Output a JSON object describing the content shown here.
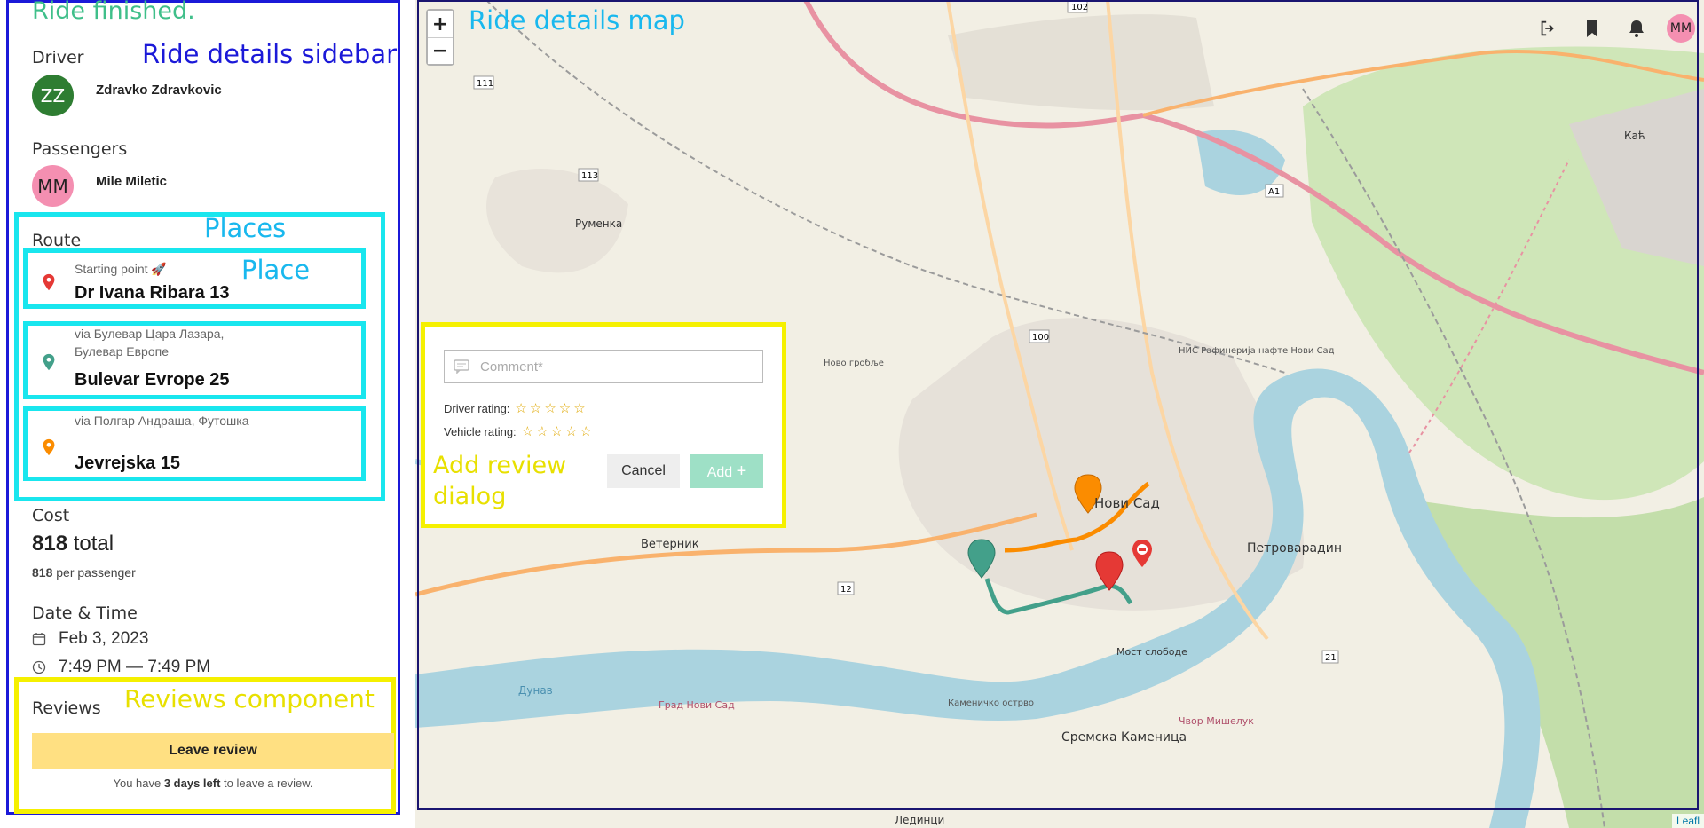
{
  "sidebar": {
    "overlay_label": "Ride details sidebar",
    "status": "Ride finished.",
    "driver": {
      "title": "Driver",
      "initials": "ZZ",
      "name": "Zdravko Zdravkovic"
    },
    "passengers": {
      "title": "Passengers",
      "items": [
        {
          "initials": "MM",
          "name": "Mile Miletic"
        }
      ]
    },
    "route": {
      "title": "Route",
      "places_label": "Places",
      "place_label": "Place",
      "places": [
        {
          "sub": "Starting point 🚀",
          "main": "Dr Ivana Ribara 13",
          "color": "#e53935"
        },
        {
          "sub": "via Булевар Цара Лазара, Булевар Европе",
          "main": "Bulevar Evrope 25",
          "color": "#43a08a"
        },
        {
          "sub": "via Полгар Андраша, Футошка",
          "main": "Jevrejska 15",
          "color": "#fb8c00"
        }
      ]
    },
    "cost": {
      "title": "Cost",
      "total_value": "818",
      "total_suffix": "total",
      "per_value": "818",
      "per_suffix": "per passenger"
    },
    "datetime": {
      "title": "Date & Time",
      "date": "Feb 3, 2023",
      "time": "7:49 PM — 7:49 PM"
    },
    "reviews": {
      "title": "Reviews",
      "overlay_label": "Reviews component",
      "button": "Leave review",
      "note_prefix": "You have ",
      "note_bold": "3 days left",
      "note_suffix": " to leave a review."
    }
  },
  "map": {
    "overlay_label": "Ride details map",
    "zoom_in": "+",
    "zoom_out": "−",
    "avatar_initials": "MM",
    "attribution": "Leafl",
    "labels": {
      "novi_sad": "Нови Сад",
      "petrovaradin": "Петроварадин",
      "sremska": "Сремска Каменица",
      "veternik": "Ветерник",
      "rumenka": "Руменка",
      "dunav": "Дунав",
      "most": "Мост слободе",
      "grad": "Град Нови Сад",
      "ledinci": "Лединци",
      "kac": "Каћ",
      "nis": "НИС Рафинерија нафте Нови Сад",
      "novo_groblje": "Ново гробље",
      "cvor": "Чвор Мишелук",
      "kamenicko": "Каменичко острво"
    },
    "road_numbers": [
      "102",
      "111",
      "113",
      "100",
      "12",
      "21",
      "A1"
    ]
  },
  "dialog": {
    "overlay_label": "Add review dialog",
    "comment_placeholder": "Comment*",
    "driver_rating_label": "Driver rating:",
    "vehicle_rating_label": "Vehicle rating:",
    "stars": "☆☆☆☆☆",
    "cancel": "Cancel",
    "add": "Add"
  }
}
